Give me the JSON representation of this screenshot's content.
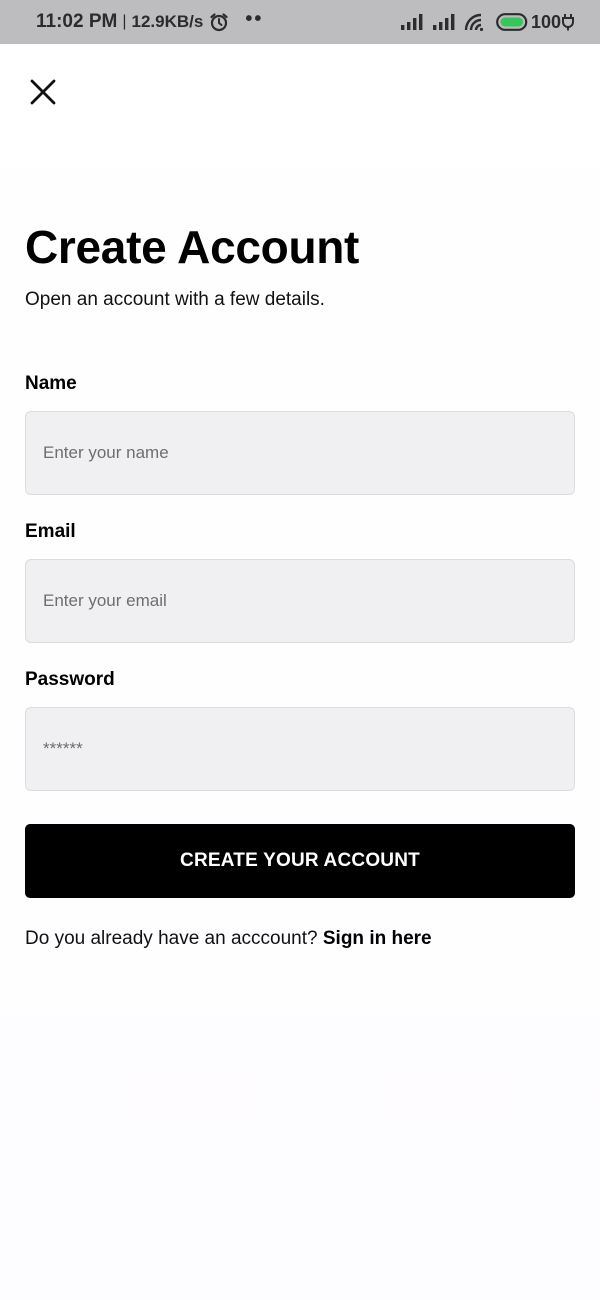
{
  "status_bar": {
    "time": "11:02 PM",
    "separator": "|",
    "network_speed": "12.9KB/s",
    "dots": "••",
    "battery_level": "100",
    "icons": [
      "alarm-icon",
      "signal-icon",
      "signal-icon",
      "wifi-icon",
      "battery-icon",
      "charging-icon"
    ]
  },
  "header": {
    "close_icon": "close-icon"
  },
  "form": {
    "title": "Create Account",
    "subtitle": "Open an account with a few details.",
    "name": {
      "label": "Name",
      "placeholder": "Enter your name",
      "value": ""
    },
    "email": {
      "label": "Email",
      "placeholder": "Enter your email",
      "value": ""
    },
    "password": {
      "label": "Password",
      "placeholder": "******",
      "value": ""
    },
    "submit_label": "CREATE YOUR ACCOUNT",
    "signin_prompt": "Do you already have an acccount?",
    "signin_link": "Sign in here"
  },
  "colors": {
    "status_bar_bg": "#bdbcbe",
    "input_bg": "#f0eff1",
    "button_bg": "#000000",
    "button_text": "#ffffff",
    "battery_fill": "#34c759"
  }
}
